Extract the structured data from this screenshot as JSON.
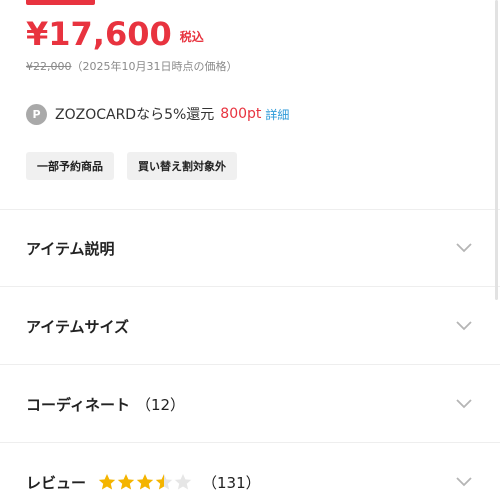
{
  "price": {
    "current": "¥17,600",
    "tax_label": "税込",
    "original": "¥22,000",
    "original_note": "（2025年10月31日時点の価格）"
  },
  "zozocard": {
    "badge": "P",
    "text": "ZOZOCARDなら5%還元",
    "points": "800pt",
    "detail_link": "詳細"
  },
  "tags": [
    "一部予約商品",
    "買い替え割対象外"
  ],
  "sections": {
    "description": {
      "title": "アイテム説明"
    },
    "size": {
      "title": "アイテムサイズ"
    },
    "coordinate": {
      "title": "コーディネート",
      "count": "（12）"
    },
    "review": {
      "title": "レビュー",
      "rating": 3.5,
      "max_rating": 5,
      "count": "（131）"
    }
  },
  "colors": {
    "accent": "#e8333f",
    "link": "#2c9ad8",
    "star": "#f4b400",
    "star_empty": "#e6e6e6"
  },
  "icons": {
    "chevron": "chevron-down-icon",
    "star": "star-icon"
  }
}
